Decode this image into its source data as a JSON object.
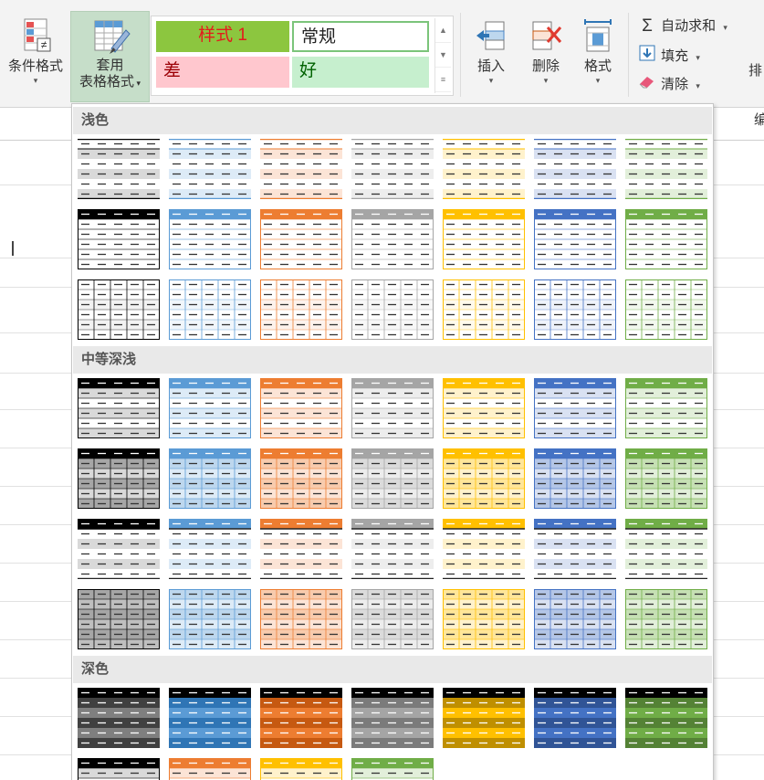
{
  "ribbon": {
    "conditional_format": {
      "label": "条件格式"
    },
    "format_as_table": {
      "label_line1": "套用",
      "label_line2": "表格格式"
    },
    "cell_styles": [
      {
        "id": "style-1",
        "label": "样式 1"
      },
      {
        "id": "normal",
        "label": "常规"
      },
      {
        "id": "bad",
        "label": "差"
      },
      {
        "id": "good",
        "label": "好"
      }
    ],
    "cells": {
      "insert": "插入",
      "delete": "删除",
      "format": "格式"
    },
    "editing": {
      "autosum": "自动求和",
      "fill": "填充",
      "clear": "清除",
      "sort_partial": "排",
      "edit_partial": "编"
    }
  },
  "gallery": {
    "sections": [
      {
        "title": "浅色"
      },
      {
        "title": "中等深浅"
      },
      {
        "title": "深色"
      }
    ],
    "palette": [
      {
        "name": "black",
        "main": "#000000",
        "light": "#d9d9d9",
        "mid": "#a6a6a6",
        "pale": "#f2f2f2",
        "dark": "#404040",
        "border": "#000000"
      },
      {
        "name": "blue",
        "main": "#5b9bd5",
        "light": "#ddebf7",
        "mid": "#bdd7ee",
        "pale": "#f0f6fb",
        "dark": "#2f75b5",
        "border": "#5b9bd5"
      },
      {
        "name": "orange",
        "main": "#ed7d31",
        "light": "#fce4d6",
        "mid": "#f8cbad",
        "pale": "#fdf2ec",
        "dark": "#c65911",
        "border": "#ed7d31"
      },
      {
        "name": "gray",
        "main": "#a5a5a5",
        "light": "#ededed",
        "mid": "#dbdbdb",
        "pale": "#f7f7f7",
        "dark": "#7b7b7b",
        "border": "#a5a5a5"
      },
      {
        "name": "gold",
        "main": "#ffc000",
        "light": "#fff2cc",
        "mid": "#ffe699",
        "pale": "#fffaeb",
        "dark": "#bf8f00",
        "border": "#ffc000"
      },
      {
        "name": "darkblue",
        "main": "#4472c4",
        "light": "#d9e1f2",
        "mid": "#b4c6e7",
        "pale": "#eef2fa",
        "dark": "#305496",
        "border": "#4472c4"
      },
      {
        "name": "green",
        "main": "#70ad47",
        "light": "#e2efda",
        "mid": "#c6e0b4",
        "pale": "#f2f8ee",
        "dark": "#548235",
        "border": "#70ad47"
      }
    ]
  }
}
